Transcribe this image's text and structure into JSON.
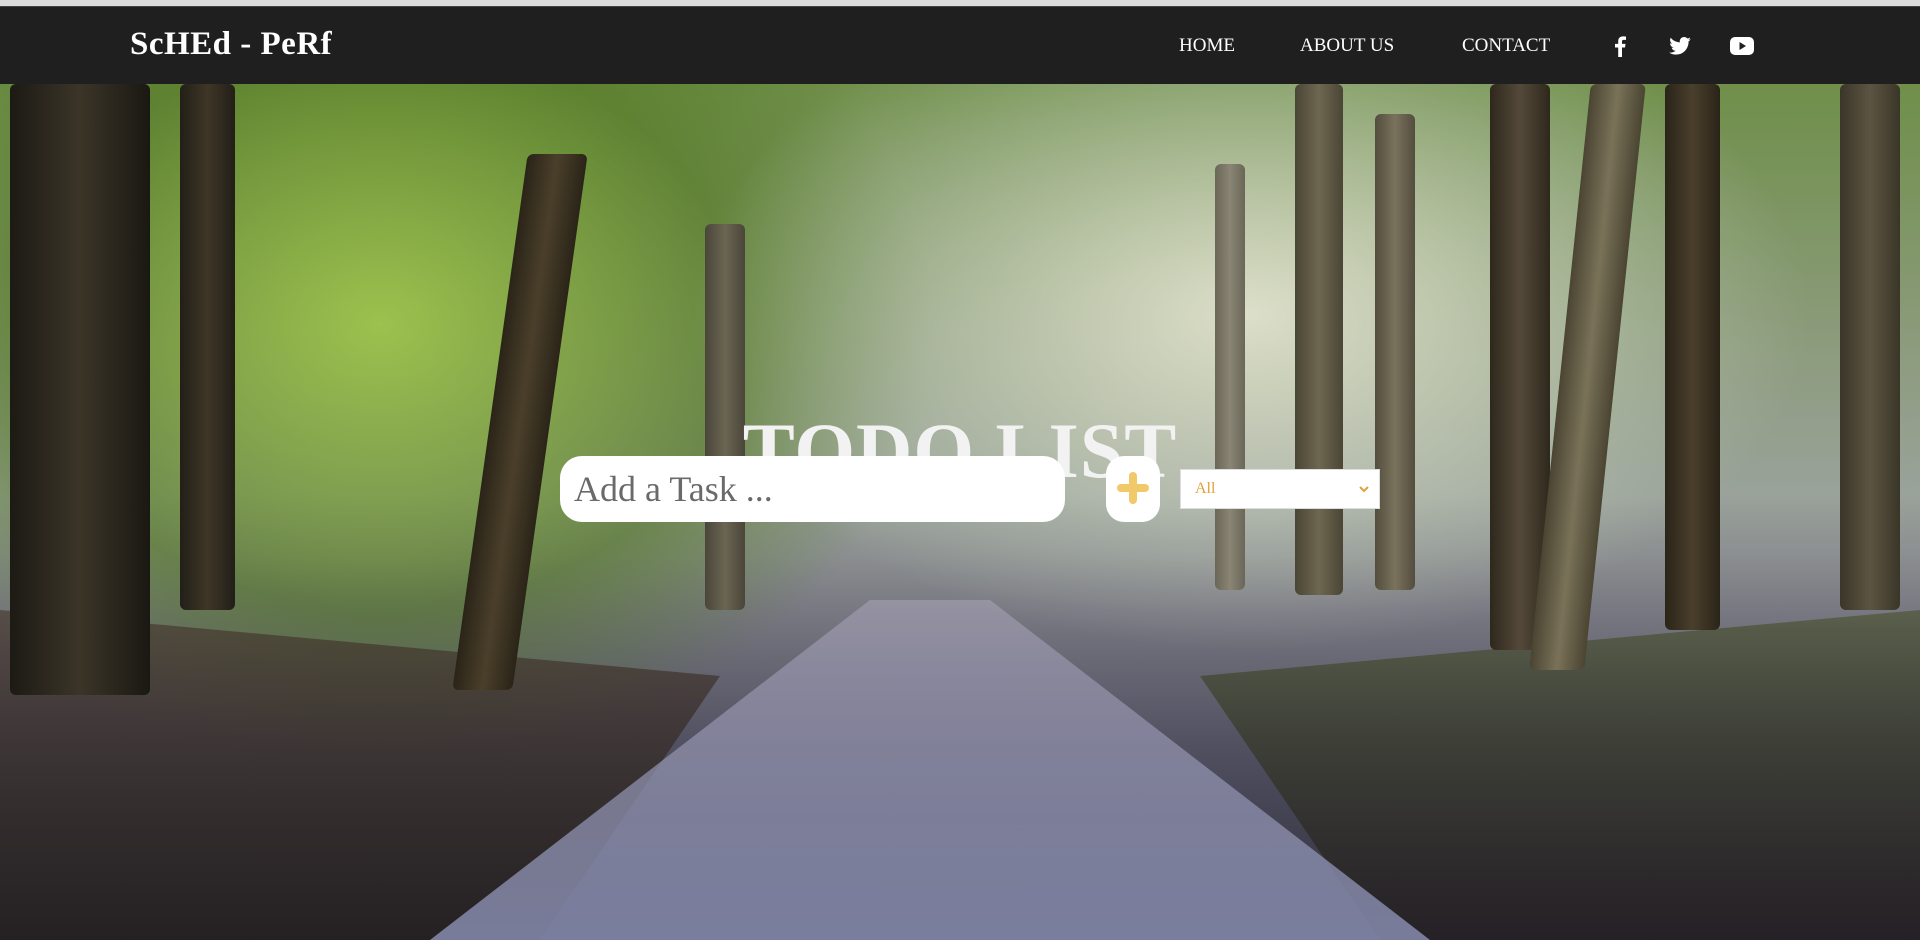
{
  "brand": {
    "name": "ScHEd - PeRf"
  },
  "nav": {
    "items": [
      {
        "label": "HOME"
      },
      {
        "label": "ABOUT US"
      },
      {
        "label": "CONTACT"
      }
    ],
    "social": [
      {
        "icon": "facebook-icon"
      },
      {
        "icon": "twitter-icon"
      },
      {
        "icon": "youtube-icon"
      }
    ]
  },
  "hero": {
    "title": "TODO LIST",
    "task_input": {
      "placeholder": "Add a Task ...",
      "value": ""
    },
    "add_button": {
      "icon": "plus-icon",
      "color": "#f1c96b"
    },
    "filter": {
      "selected": "All",
      "color": "#e0a13a"
    }
  }
}
